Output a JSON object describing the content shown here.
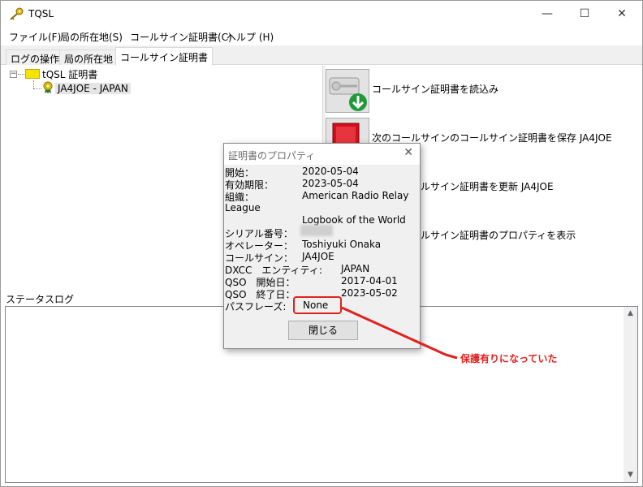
{
  "window": {
    "title": "TQSL"
  },
  "menu": [
    "ファイル(F)",
    "局の所在地(S)",
    "コールサイン証明書(C)",
    "ヘルプ (H)"
  ],
  "tabs": [
    "ログの操作",
    "局の所在地",
    "コールサイン証明書"
  ],
  "tree": {
    "root_label": "tQSL 証明書",
    "child_label": "JA4JOE - JAPAN"
  },
  "actions": [
    {
      "label": "コールサイン証明書を読込み",
      "icon": "certificate-download-icon"
    },
    {
      "label": "次のコールサインのコールサイン証明書を保存 JA4JOE",
      "icon": "save-book-icon"
    },
    {
      "label": "インのコールサイン証明書を更新 JA4JOE",
      "icon": "renew-icon"
    },
    {
      "label": "インのコールサイン証明書のプロパティを表示",
      "icon": "properties-icon"
    }
  ],
  "status": {
    "label": "ステータスログ"
  },
  "dialog": {
    "title": "証明書のプロパティ",
    "props": [
      {
        "label": "開始：",
        "value": "2020-05-04"
      },
      {
        "label": "有効期限：",
        "value": "2023-05-04"
      },
      {
        "label": "組織：",
        "value": "American Radio Relay"
      },
      {
        "label": "League",
        "value": ""
      },
      {
        "label": "",
        "value": "Logbook of the World"
      },
      {
        "label": "シリアル番号：",
        "value": ""
      },
      {
        "label": "オペレーター：",
        "value": "Toshiyuki Onaka"
      },
      {
        "label": "コールサイン：",
        "value": "JA4JOE"
      },
      {
        "label": "DXCC　エンティティ:",
        "value": "JAPAN"
      },
      {
        "label": "QSO　開始日：",
        "value": "2017-04-01"
      },
      {
        "label": "QSO　終了日：",
        "value": "2023-05-02"
      },
      {
        "label": "パスフレーズ:",
        "value": "None"
      }
    ],
    "close_button": "閉じる"
  },
  "annotation": {
    "text": "保護有りになっていた",
    "color": "#e0221e"
  }
}
